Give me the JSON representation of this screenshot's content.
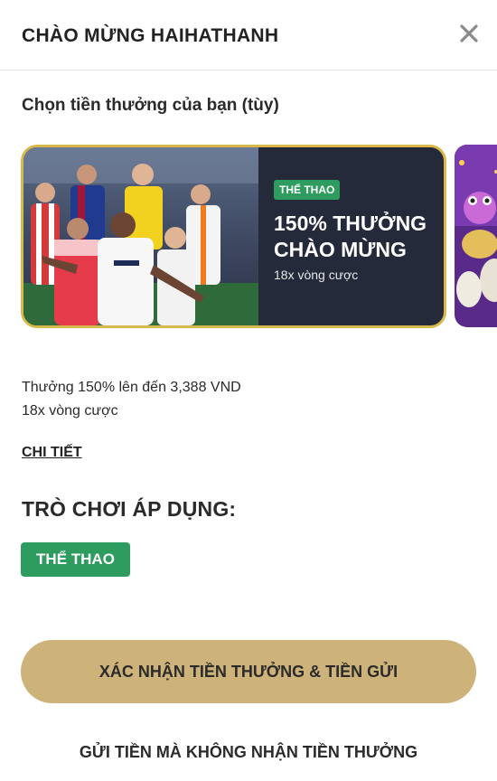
{
  "header": {
    "title": "CHÀO MỪNG HAIHATHANH",
    "close_icon": "close-icon"
  },
  "subtitle": "Chọn tiền thưởng của bạn (tùy)",
  "bonus_card": {
    "badge": "THỂ THAO",
    "title": "150% THƯỞNG CHÀO MỪNG",
    "wager": "18x vòng cược",
    "art_icon": "football-players-image",
    "border_color": "#d9b84a",
    "background_color": "#242a3a"
  },
  "next_card": {
    "art_icon": "casino-toy-image"
  },
  "description": {
    "line1": "Thưởng 150% lên đến 3,388 VND",
    "line2": "18x vòng cược"
  },
  "details_link": "CHI TIẾT",
  "games_heading": "TRÒ CHƠI ÁP DỤNG:",
  "game_tag": "THỂ THAO",
  "confirm_button": "XÁC NHẬN TIỀN THƯỞNG & TIỀN GỬI",
  "skip_button": "GỬI TIỀN MÀ KHÔNG NHẬN TIỀN THƯỞNG",
  "colors": {
    "accent_gold": "#cdb27a",
    "tag_green": "#2e9c5e"
  }
}
